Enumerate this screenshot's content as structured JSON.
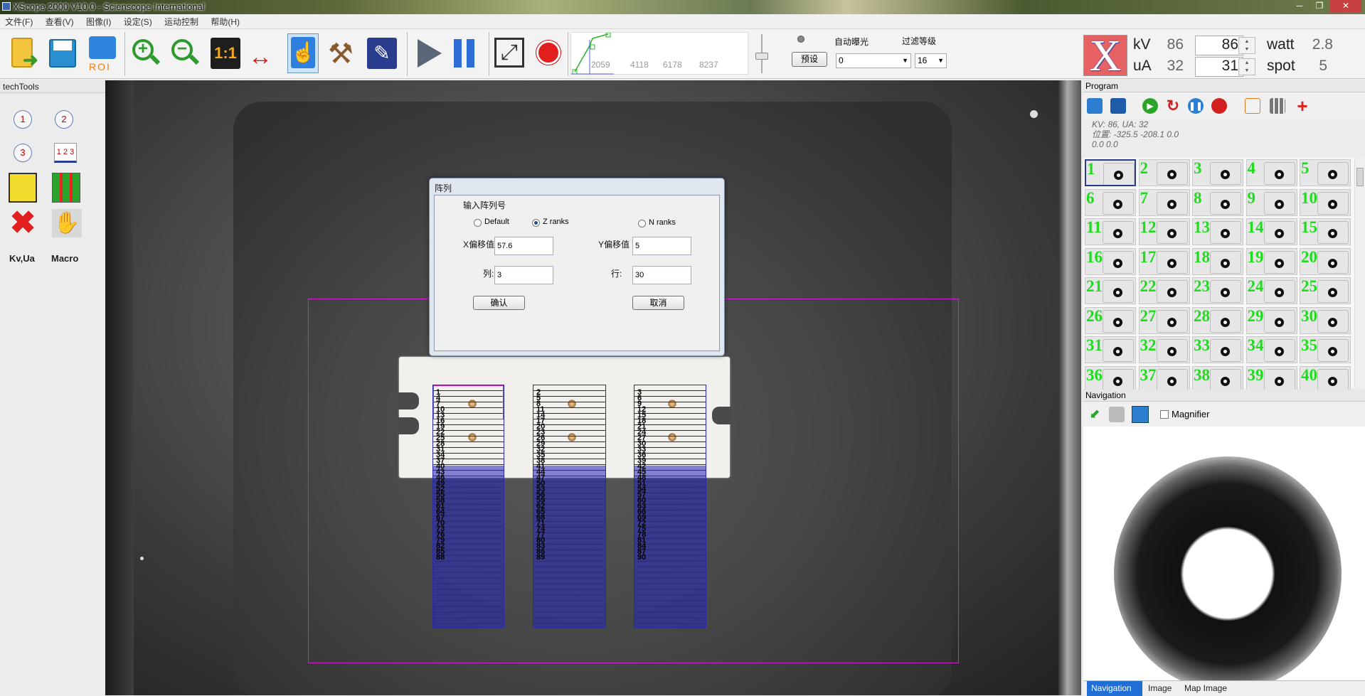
{
  "window": {
    "title": "XScope 2000 V10.0 - Scienscope International",
    "controls": [
      "─",
      "❐",
      "✕"
    ]
  },
  "menu": [
    "文件(F)",
    "查看(V)",
    "图像(I)",
    "设定(S)",
    "运动控制",
    "帮助(H)"
  ],
  "toolbar": {
    "roi_label": "ROI",
    "ratio_label": "1:1"
  },
  "histogram": {
    "ticks": [
      "2059",
      "4118",
      "6178",
      "8237"
    ]
  },
  "exposure": {
    "auto_label": "自动曝光",
    "preset_label": "预设",
    "preset_value": "0",
    "filter_label": "过滤等级",
    "filter_value": "16"
  },
  "xray": {
    "logo": "X",
    "kv_label": "kV",
    "kv_actual": "86",
    "kv_set": "86",
    "ua_label": "uA",
    "ua_actual": "32",
    "ua_set": "31",
    "watt_label": "watt",
    "watt_value": "2.8",
    "spot_label": "spot",
    "spot_value": "5"
  },
  "tech_tools": {
    "title": "techTools",
    "items": [
      "1",
      "2",
      "3",
      "1 2 3"
    ],
    "kvua_label": "Kv,Ua",
    "macro_label": "Macro"
  },
  "dialog": {
    "title": "阵列",
    "group_label": "输入阵列号",
    "options": [
      {
        "label": "Default",
        "selected": false
      },
      {
        "label": "Z ranks",
        "selected": true
      },
      {
        "label": "N ranks",
        "selected": false
      }
    ],
    "x_offset_label": "X偏移值",
    "x_offset_value": "57.6",
    "y_offset_label": "Y偏移值",
    "y_offset_value": "5",
    "cols_label": "列:",
    "cols_value": "3",
    "rows_label": "行:",
    "rows_value": "30",
    "ok_label": "确认",
    "cancel_label": "取消"
  },
  "array_columns": [
    {
      "numbers": [
        "1",
        "4",
        "7",
        "10",
        "13",
        "16",
        "19",
        "22",
        "25",
        "28",
        "31",
        "34",
        "37",
        "40",
        "43",
        "46",
        "49",
        "52",
        "55",
        "58",
        "61",
        "64",
        "67",
        "70",
        "73",
        "76",
        "79",
        "82",
        "85",
        "88"
      ]
    },
    {
      "numbers": [
        "2",
        "5",
        "8",
        "11",
        "14",
        "17",
        "20",
        "23",
        "26",
        "29",
        "32",
        "35",
        "38",
        "41",
        "44",
        "47",
        "50",
        "53",
        "56",
        "59",
        "62",
        "65",
        "68",
        "71",
        "74",
        "77",
        "80",
        "83",
        "86",
        "89"
      ]
    },
    {
      "numbers": [
        "3",
        "6",
        "9",
        "12",
        "15",
        "18",
        "21",
        "24",
        "27",
        "30",
        "33",
        "36",
        "39",
        "42",
        "45",
        "48",
        "51",
        "54",
        "57",
        "60",
        "63",
        "66",
        "69",
        "72",
        "75",
        "78",
        "81",
        "84",
        "87",
        "90"
      ]
    }
  ],
  "program": {
    "title": "Program",
    "info_line1": "KV: 86, UA: 32",
    "info_line2": "位置: -325.5 -208.1 0.0",
    "info_line3": "0.0 0.0",
    "thumbs": [
      "1",
      "2",
      "3",
      "4",
      "5",
      "6",
      "7",
      "8",
      "9",
      "10",
      "11",
      "12",
      "13",
      "14",
      "15",
      "16",
      "17",
      "18",
      "19",
      "20",
      "21",
      "22",
      "23",
      "24",
      "25",
      "26",
      "27",
      "28",
      "29",
      "30",
      "31",
      "32",
      "33",
      "34",
      "35",
      "36",
      "37",
      "38",
      "39",
      "40"
    ]
  },
  "navigation": {
    "title": "Navigation",
    "magnifier_label": "Magnifier",
    "tabs": [
      "Navigation",
      "Image",
      "Map Image"
    ],
    "active_tab": "Navigation"
  },
  "colors": {
    "roi": "#d020d0",
    "array_grid": "#2020aa",
    "thumb_number": "#1fdc1f",
    "xlogo_bg": "#e76363"
  }
}
